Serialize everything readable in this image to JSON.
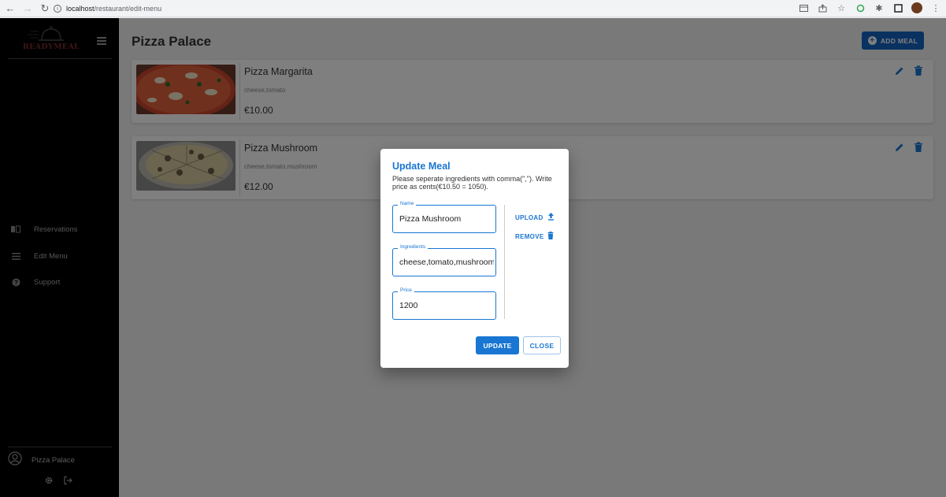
{
  "browser": {
    "url_host": "localhost",
    "url_path": "/restaurant/edit-menu"
  },
  "sidebar": {
    "logo_text": "READYMEAL",
    "items": [
      {
        "label": "Reservations",
        "icon": "book-open-icon"
      },
      {
        "label": "Edit Menu",
        "icon": "list-icon"
      },
      {
        "label": "Support",
        "icon": "question-circle-icon"
      }
    ],
    "user_name": "Pizza Palace"
  },
  "header": {
    "title": "Pizza Palace",
    "add_meal_label": "ADD MEAL"
  },
  "meals": [
    {
      "name": "Pizza Margarita",
      "ingredients": "cheese,tomato",
      "price": "€10.00"
    },
    {
      "name": "Pizza Mushroom",
      "ingredients": "cheese,tomato,mushroom",
      "price": "€12.00"
    }
  ],
  "dialog": {
    "title": "Update Meal",
    "description": "Please seperate ingredients with comma(\",\"). Write price as cents(€10.50 = 1050).",
    "fields": {
      "name": {
        "label": "Name",
        "value": "Pizza Mushroom"
      },
      "ingredients": {
        "label": "Ingredients",
        "value": "cheese,tomato,mushroom"
      },
      "price": {
        "label": "Price",
        "value": "1200"
      }
    },
    "upload_label": "UPLOAD",
    "remove_label": "REMOVE",
    "update_label": "UPDATE",
    "close_label": "CLOSE"
  },
  "colors": {
    "primary": "#1976d2",
    "sidebar_bg": "#000000",
    "logo": "#7d2a2a"
  }
}
